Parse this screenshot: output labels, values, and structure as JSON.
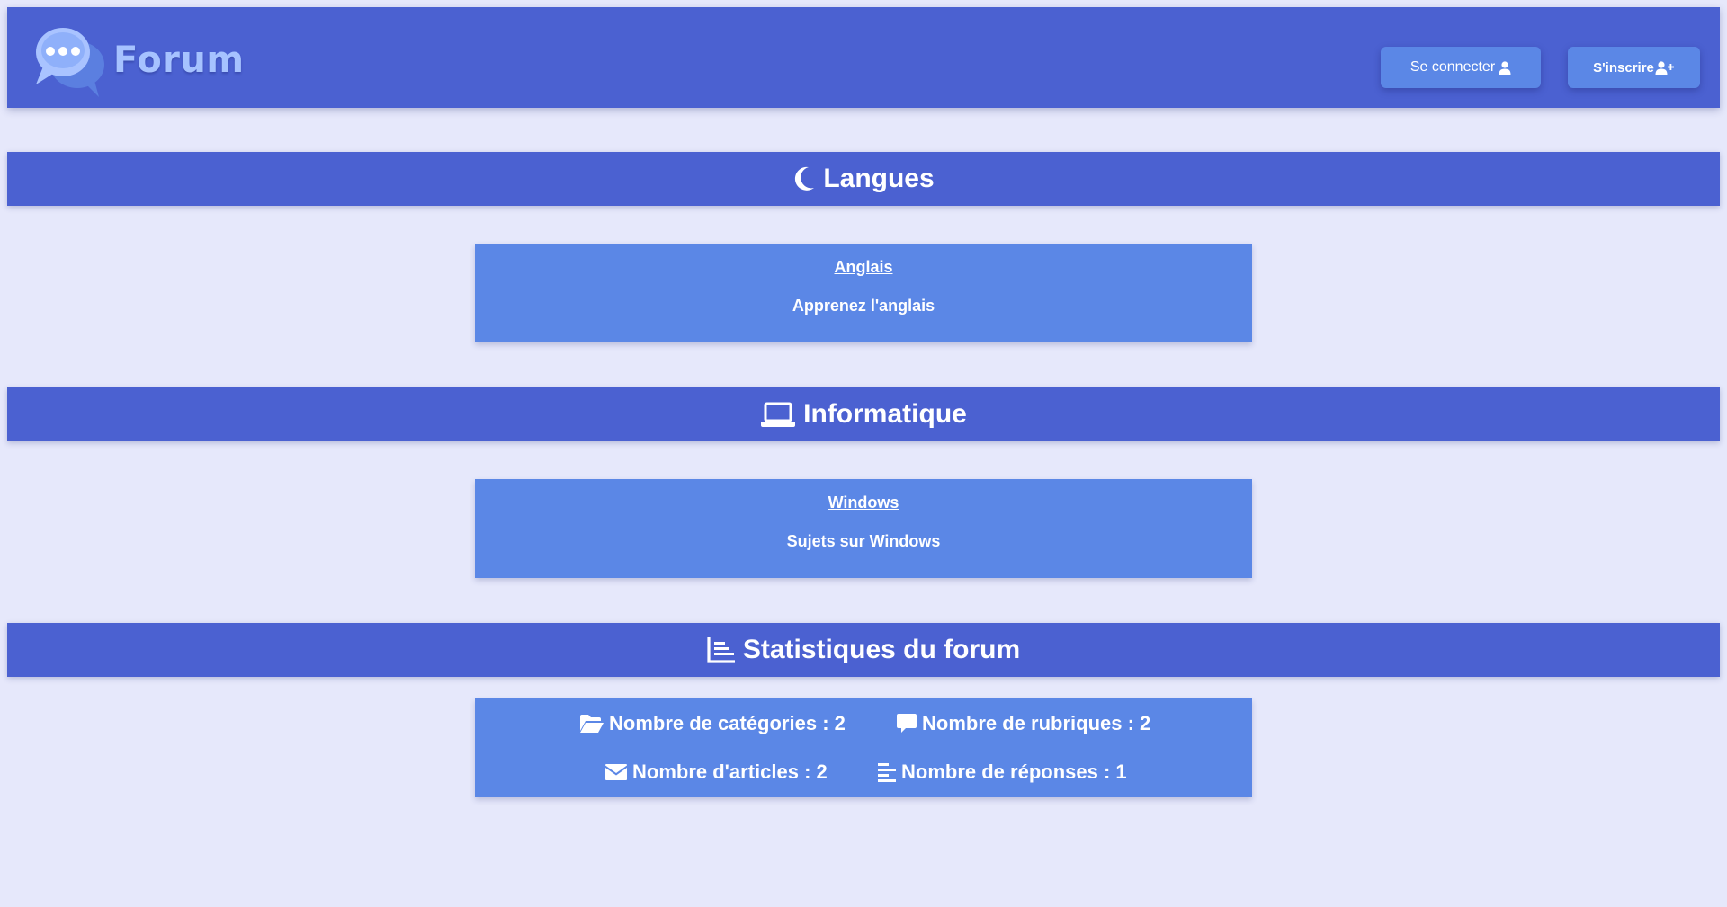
{
  "header": {
    "logo_text": "Forum",
    "login_label": "Se connecter",
    "register_label": "S'inscrire"
  },
  "sections": [
    {
      "title": "Langues",
      "icon": "moon-icon",
      "rubriques": [
        {
          "title": "Anglais",
          "description": "Apprenez l'anglais"
        }
      ]
    },
    {
      "title": "Informatique",
      "icon": "laptop-icon",
      "rubriques": [
        {
          "title": "Windows",
          "description": "Sujets sur Windows"
        }
      ]
    }
  ],
  "stats": {
    "title": "Statistiques du forum",
    "icon": "chart-bar-icon",
    "categories": {
      "label": "Nombre de catégories : 2",
      "icon": "folder-open-icon"
    },
    "rubriques": {
      "label": "Nombre de rubriques : 2",
      "icon": "comment-icon"
    },
    "articles": {
      "label": "Nombre d'articles : 2",
      "icon": "envelope-icon"
    },
    "reponses": {
      "label": "Nombre de réponses : 1",
      "icon": "align-left-icon"
    }
  },
  "colors": {
    "background": "#e6e8fb",
    "bar": "#4b61d1",
    "card": "#5b87e6",
    "logo_text": "#a6c2ff",
    "text": "#ffffff"
  }
}
